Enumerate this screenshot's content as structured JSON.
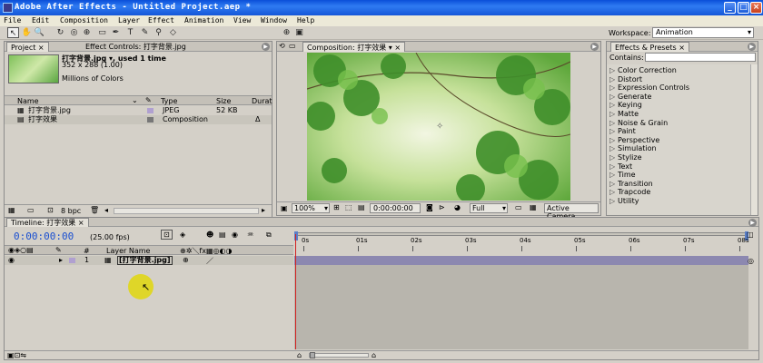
{
  "window": {
    "title": "Adobe After Effects - Untitled Project.aep *",
    "min": "_",
    "max": "□",
    "close": "×"
  },
  "menu": [
    "File",
    "Edit",
    "Composition",
    "Layer",
    "Effect",
    "Animation",
    "View",
    "Window",
    "Help"
  ],
  "toolbar": {
    "workspace_label": "Workspace:",
    "workspace_value": "Animation"
  },
  "project": {
    "tab_project": "Project",
    "tab_effect_controls": "Effect Controls: 打字背景.jpg",
    "selected_name": "打字背景.jpg ▾, used 1 time",
    "selected_dims": "352 x 288 (1.00)",
    "selected_colors": "Millions of Colors",
    "columns": [
      "Name",
      "Type",
      "Size",
      "Durat"
    ],
    "items": [
      {
        "name": "打字背景.jpg",
        "type": "JPEG",
        "size": "52 KB",
        "dur": ""
      },
      {
        "name": "打字效果",
        "type": "Composition",
        "size": "",
        "dur": "Δ"
      }
    ],
    "footer_bpc": "8 bpc"
  },
  "composition": {
    "tab": "Composition: 打字效果",
    "zoom": "100%",
    "time": "0:00:00:00",
    "resolution": "Full",
    "camera": "Active Camera"
  },
  "effects": {
    "tab": "Effects & Presets",
    "contains_label": "Contains:",
    "items": [
      "Color Correction",
      "Distort",
      "Expression Controls",
      "Generate",
      "Keying",
      "Matte",
      "Noise & Grain",
      "Paint",
      "Perspective",
      "Simulation",
      "Stylize",
      "Text",
      "Time",
      "Transition",
      "Trapcode",
      "Utility"
    ]
  },
  "timeline": {
    "tab": "Timeline: 打字效果",
    "timecode": "0:00:00:00",
    "fps": "(25.00 fps)",
    "col_num": "#",
    "col_layer": "Layer Name",
    "ruler": [
      "0s",
      "01s",
      "02s",
      "03s",
      "04s",
      "05s",
      "06s",
      "07s",
      "08s"
    ],
    "layers": [
      {
        "num": "1",
        "name": "[打字背景.jpg]"
      }
    ]
  },
  "colors": {
    "accent": "#1456d8",
    "timecode": "#1a4fd0",
    "playhead": "#d22020",
    "layerbar": "#8c88b0"
  }
}
